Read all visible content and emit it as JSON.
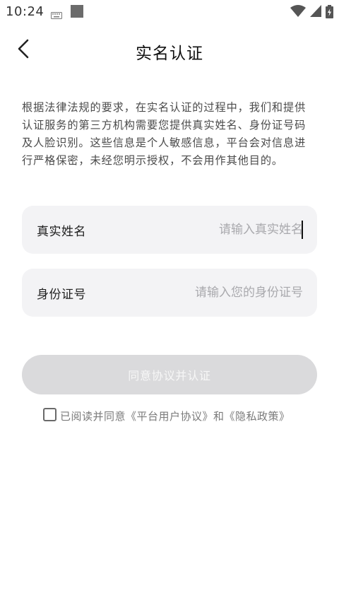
{
  "status_bar": {
    "time": "10:24",
    "icons": [
      "keyboard-icon",
      "notification-square-icon",
      "wifi-icon",
      "signal-icon",
      "battery-charging-icon"
    ]
  },
  "header": {
    "title": "实名认证",
    "back_icon": "chevron-left-icon"
  },
  "notice": {
    "text": "根据法律法规的要求，在实名认证的过程中，我们和提供认证服务的第三方机构需要您提供真实姓名、身份证号码及人脸识别。这些信息是个人敏感信息，平台会对信息进行严格保密，未经您明示授权，不会用作其他目的。"
  },
  "form": {
    "name_label": "真实姓名",
    "name_placeholder": "请输入真实姓名",
    "name_value": "",
    "id_label": "身份证号",
    "id_placeholder": "请输入您的身份证号",
    "id_value": ""
  },
  "submit": {
    "label": "同意协议并认证",
    "disabled": true
  },
  "agreement": {
    "checked": false,
    "prefix": "已阅读并同意",
    "platform_link": "《平台用户协议》",
    "conjunction": "和",
    "privacy_link": "《隐私政策》"
  },
  "colors": {
    "field_bg": "#f3f3f5",
    "button_disabled_bg": "#dadadc",
    "placeholder": "#a9a9ad",
    "text_primary": "#111111",
    "text_secondary": "#4a4a4a"
  }
}
